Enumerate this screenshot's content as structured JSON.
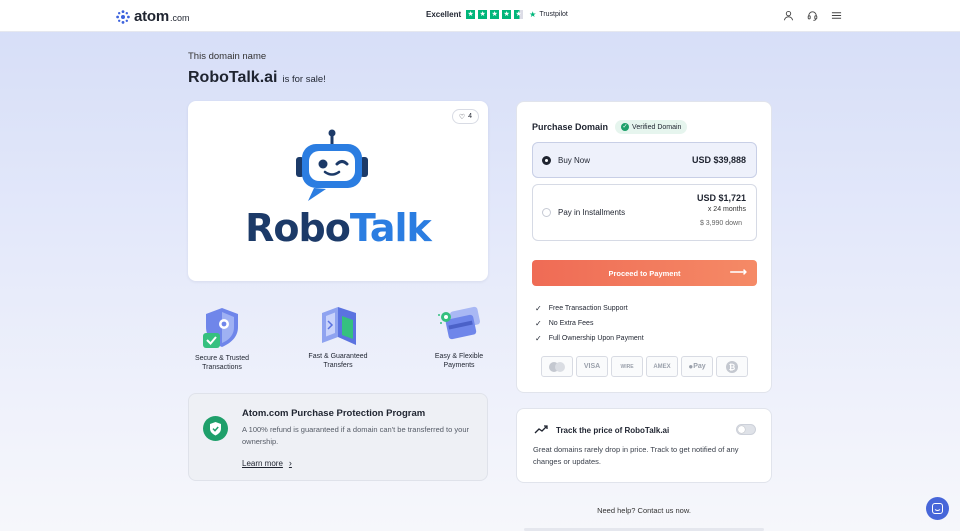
{
  "header": {
    "logo_text": "atom",
    "logo_suffix": ".com",
    "rating_label": "Excellent",
    "rating_stars": 4.5,
    "trust_brand": "Trustpilot",
    "icons": [
      "user-icon",
      "headset-icon",
      "menu-icon"
    ]
  },
  "hero": {
    "pre_title": "This domain name",
    "domain": "RoboTalk.ai",
    "suffix": "is for sale!"
  },
  "logo_card": {
    "likes": "4",
    "brand_first": "Robo",
    "brand_second": "Talk",
    "colors": {
      "dark": "#1c3a68",
      "accent": "#2b7de1"
    }
  },
  "features": [
    {
      "icon": "shield-check-icon",
      "label": "Secure & Trusted Transactions"
    },
    {
      "icon": "transfer-icon",
      "label": "Fast & Guaranteed Transfers"
    },
    {
      "icon": "card-payment-icon",
      "label": "Easy & Flexible Payments"
    }
  ],
  "protection": {
    "title": "Atom.com Purchase Protection Program",
    "text": "A 100% refund is guaranteed if a domain can't be transferred to your ownership.",
    "link": "Learn more"
  },
  "purchase": {
    "title": "Purchase Domain",
    "verified": "Verified Domain",
    "buy_label": "Buy Now",
    "buy_price": "USD $39,888",
    "inst_label": "Pay in Installments",
    "inst_price": "USD $1,721",
    "inst_months": "x 24 months",
    "inst_down": "$ 3,990 down",
    "selected": "buy",
    "cta": "Proceed to Payment",
    "cta_color": "#ef6b55",
    "benefits": [
      "Free Transaction Support",
      "No Extra Fees",
      "Full Ownership Upon Payment"
    ],
    "payment_methods": [
      "mastercard",
      "VISA",
      "WIRE",
      "AMEX",
      "Pay",
      "bitcoin"
    ]
  },
  "tracker": {
    "title": "Track the price of RoboTalk.ai",
    "text": "Great domains rarely drop in price. Track to get notified of any changes or updates.",
    "enabled": false
  },
  "footer": {
    "help": "Need help? Contact us now."
  }
}
